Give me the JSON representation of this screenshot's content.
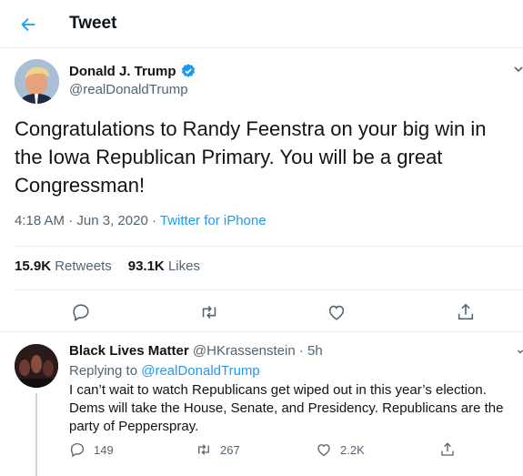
{
  "header": {
    "title": "Tweet"
  },
  "tweet": {
    "author_name": "Donald J. Trump",
    "author_handle": "@realDonaldTrump",
    "text": "Congratulations to Randy Feenstra on your big win in the Iowa Republican Primary. You will be a great Congressman!",
    "time": "4:18 AM",
    "separator": " · ",
    "date": "Jun 3, 2020",
    "source": "Twitter for iPhone",
    "retweets_count": "15.9K",
    "retweets_label": "Retweets",
    "likes_count": "93.1K",
    "likes_label": "Likes",
    "accent_color": "#1d9bf0"
  },
  "reply": {
    "author_name": "Black Lives Matter",
    "author_handle": "@HKrassenstein",
    "time": "5h",
    "separator": " · ",
    "replying_label": "Replying to",
    "replying_to": "@realDonaldTrump",
    "text": "I can’t wait to watch Republicans get wiped out in this year’s election. Dems will take the House, Senate, and Presidency. Republicans are the party of Pepperspray.",
    "reply_count": "149",
    "retweet_count": "267",
    "like_count": "2.2K"
  },
  "icons": [
    "back-arrow-icon",
    "verified-badge-icon",
    "more-icon",
    "reply-icon",
    "retweet-icon",
    "like-icon",
    "share-icon"
  ]
}
